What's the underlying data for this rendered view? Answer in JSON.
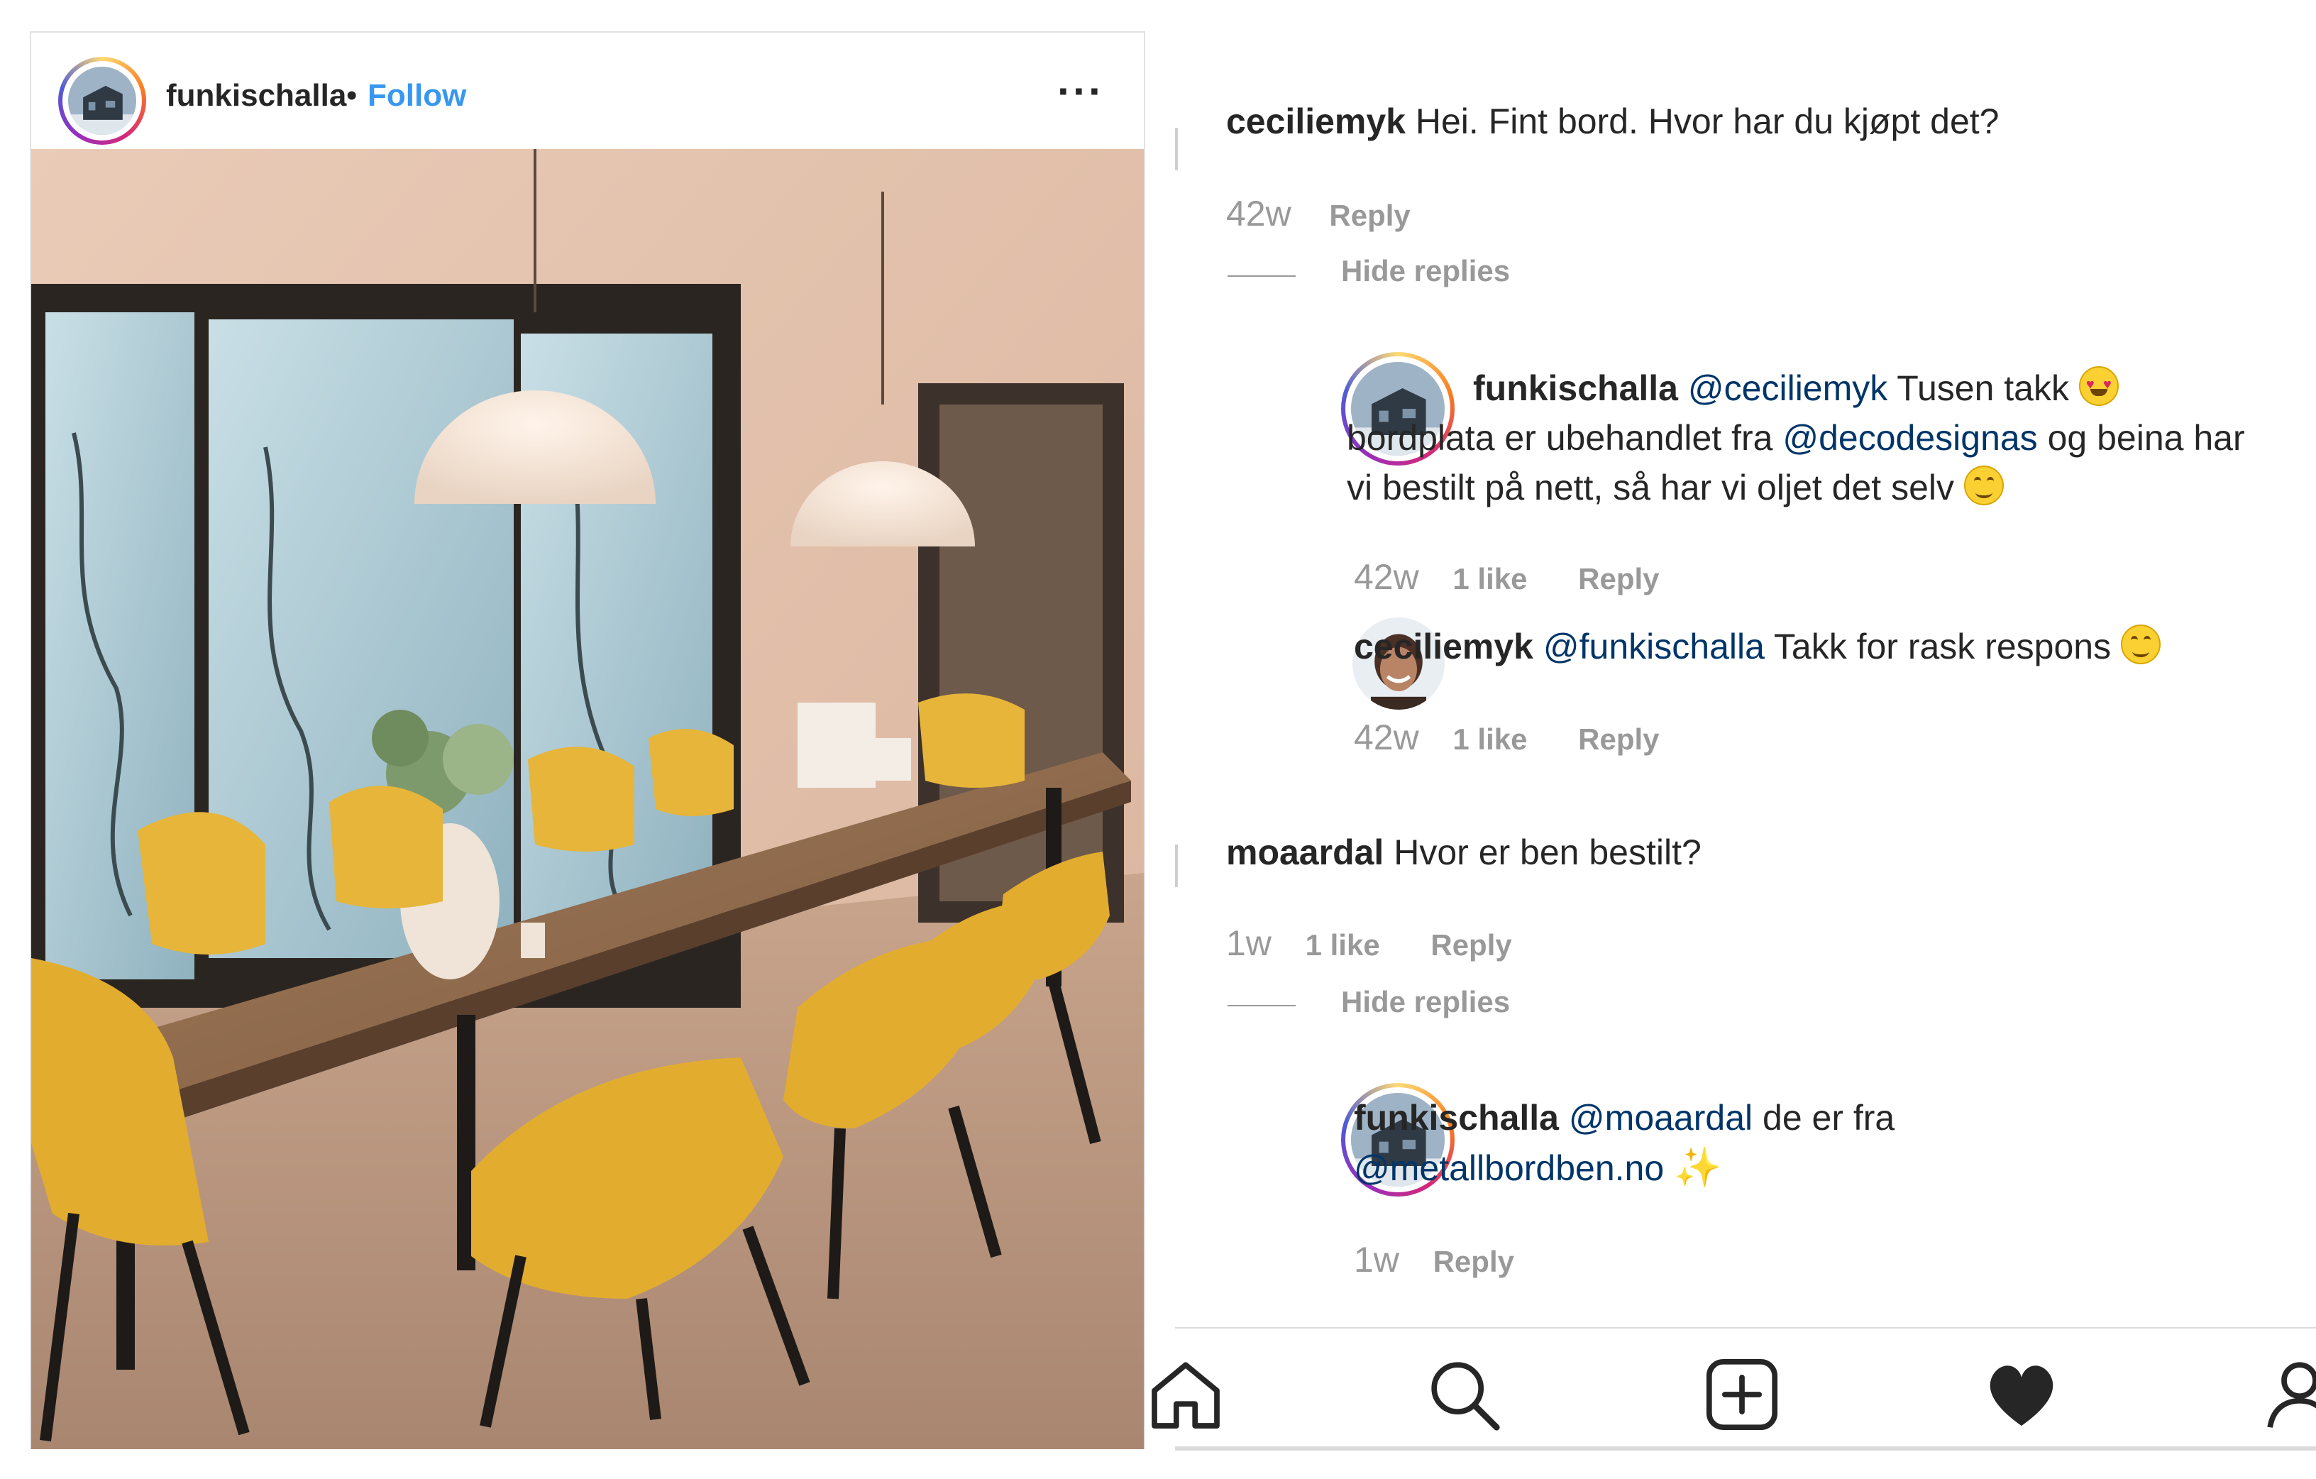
{
  "post": {
    "username": "funkischalla",
    "separator": "•",
    "follow_label": "Follow",
    "more_label": "···"
  },
  "comments": [
    {
      "user": "ceciliemyk",
      "text": "Hei. Fint bord. Hvor har du kjøpt det?",
      "age": "42w",
      "reply_label": "Reply",
      "toggle_label": "Hide replies"
    },
    {
      "user": "funkischalla",
      "mention1": "@ceciliemyk",
      "text1": "Tusen takk",
      "text2": "bordplata er ubehandlet fra",
      "mention2": "@decodesignas",
      "text3": "og beina har vi bestilt på nett, så har vi oljet det selv",
      "age": "42w",
      "likes": "1 like",
      "reply_label": "Reply"
    },
    {
      "user": "ceciliemyk",
      "mention1": "@funkischalla",
      "text1": "Takk for rask respons",
      "age": "42w",
      "likes": "1 like",
      "reply_label": "Reply"
    },
    {
      "user": "moaardal",
      "text": "Hvor er ben bestilt?",
      "age": "1w",
      "likes": "1 like",
      "reply_label": "Reply",
      "toggle_label": "Hide replies"
    },
    {
      "user": "funkischalla",
      "mention1": "@moaardal",
      "text1": "de er fra",
      "mention2": "@metallbordben.no",
      "age": "1w",
      "reply_label": "Reply"
    }
  ],
  "nav": {
    "icons": [
      "home-icon",
      "search-icon",
      "add-post-icon",
      "activity-heart-icon",
      "profile-icon"
    ]
  }
}
